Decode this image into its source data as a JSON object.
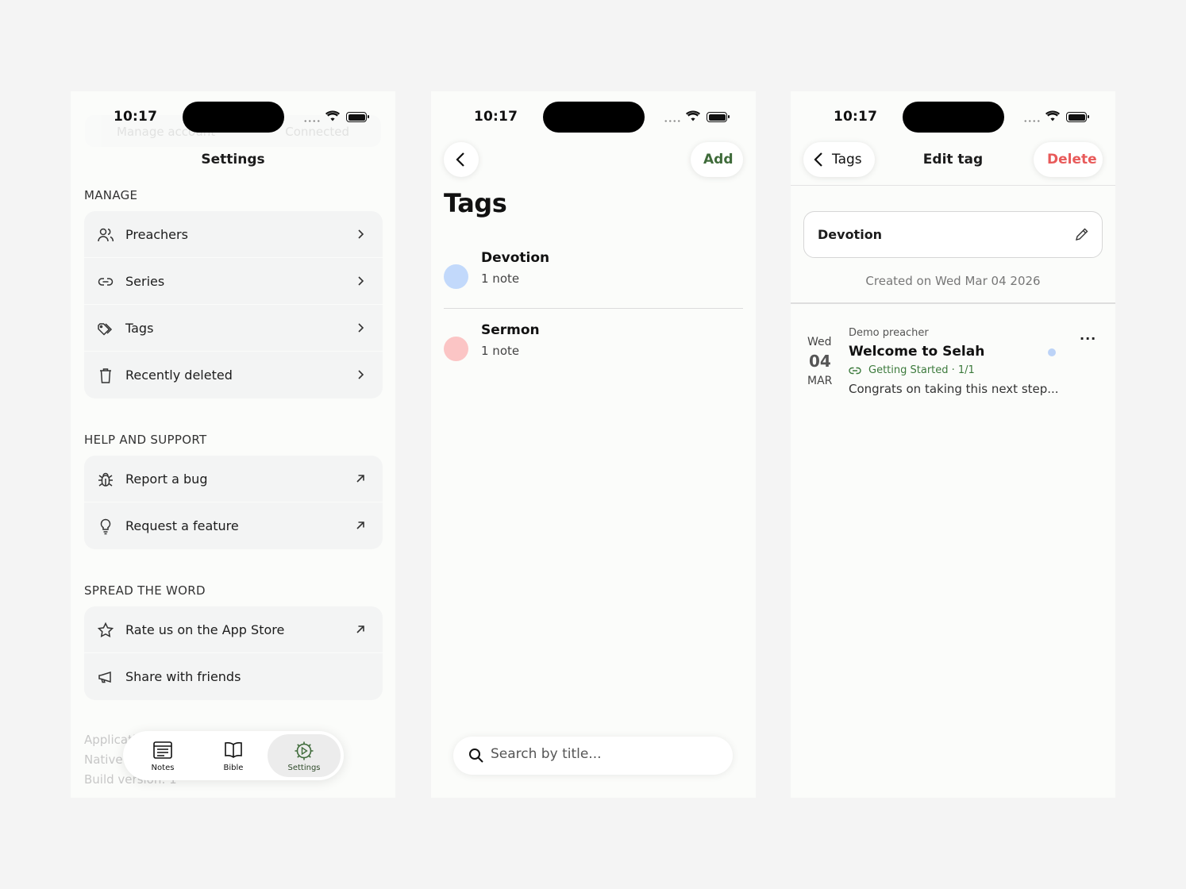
{
  "status": {
    "time": "10:17"
  },
  "settings": {
    "ghost": {
      "left": "Manage account",
      "right": "Connected"
    },
    "title": "Settings",
    "sections": [
      {
        "label": "MANAGE",
        "items": [
          {
            "label": "Preachers",
            "icon": "users-icon",
            "end": "chevron-right-icon"
          },
          {
            "label": "Series",
            "icon": "link-icon",
            "end": "chevron-right-icon"
          },
          {
            "label": "Tags",
            "icon": "tags-icon",
            "end": "chevron-right-icon"
          },
          {
            "label": "Recently deleted",
            "icon": "trash-icon",
            "end": "chevron-right-icon"
          }
        ]
      },
      {
        "label": "HELP AND SUPPORT",
        "items": [
          {
            "label": "Report a bug",
            "icon": "bug-icon",
            "end": "external-arrow-icon"
          },
          {
            "label": "Request a feature",
            "icon": "lightbulb-icon",
            "end": "external-arrow-icon"
          }
        ]
      },
      {
        "label": "SPREAD THE WORD",
        "items": [
          {
            "label": "Rate us on the App Store",
            "icon": "star-icon",
            "end": "external-arrow-icon"
          },
          {
            "label": "Share with friends",
            "icon": "megaphone-icon",
            "end": ""
          }
        ]
      }
    ],
    "footer": {
      "line1": "Application version 1.0.0",
      "line2": "Native version 1.0.0",
      "line3": "Build version: 1"
    },
    "tabs": [
      {
        "label": "Notes",
        "icon": "notes-icon"
      },
      {
        "label": "Bible",
        "icon": "book-icon"
      },
      {
        "label": "Settings",
        "icon": "settings-gear-icon"
      }
    ]
  },
  "tags_screen": {
    "add_label": "Add",
    "title": "Tags",
    "tags": [
      {
        "name": "Devotion",
        "count": "1 note",
        "color": "#c2d9fb"
      },
      {
        "name": "Sermon",
        "count": "1 note",
        "color": "#fbc5c5"
      }
    ],
    "search_placeholder": "Search by title..."
  },
  "edit_tag": {
    "back_label": "Tags",
    "title": "Edit tag",
    "delete_label": "Delete",
    "delete_color": "#e85a5a",
    "field_value": "Devotion",
    "created": "Created on Wed Mar 04 2026",
    "note": {
      "weekday": "Wed",
      "day": "04",
      "month": "MAR",
      "preacher": "Demo preacher",
      "title": "Welcome to Selah",
      "series": "Getting Started · 1/1",
      "snippet": "Congrats on taking this next step...",
      "more": "..."
    }
  },
  "colors": {
    "accent_green": "#3f6b3a",
    "danger": "#e85a5a"
  }
}
